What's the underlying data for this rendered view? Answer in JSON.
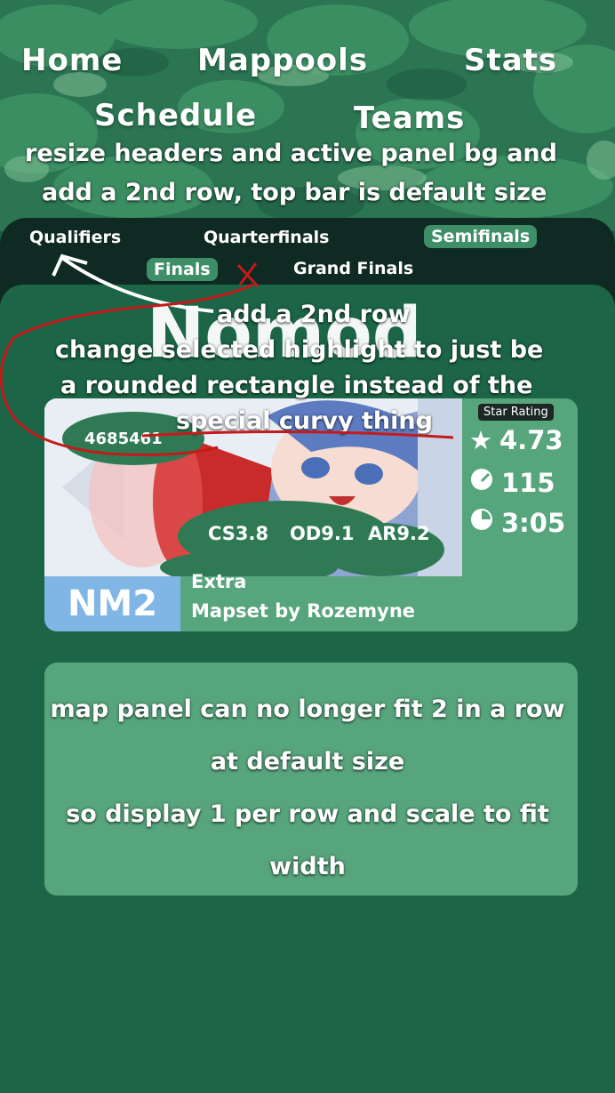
{
  "nav": {
    "home": "Home",
    "mappools": "Mappools",
    "stats": "Stats",
    "schedule": "Schedule",
    "teams": "Teams"
  },
  "notes": {
    "header_line1": "resize headers and active panel bg and",
    "header_line2": "add a 2nd row, top bar is default size",
    "row_note": "add a 2nd row",
    "highlight_line1": "change selected highlight to just be",
    "highlight_line2": "a rounded rectangle instead of the",
    "highlight_line3": "special curvy thing",
    "panel_line1": "map panel can no longer fit 2 in a row",
    "panel_line2": "at default size",
    "panel_line3": "so display 1 per row and scale to fit",
    "panel_line4": "width"
  },
  "tabs": {
    "qualifiers": "Qualifiers",
    "quarterfinals": "Quarterfinals",
    "semifinals": "Semifinals",
    "finals": "Finals",
    "grand_finals": "Grand Finals",
    "active": "semifinals"
  },
  "pool": {
    "heading": "Nomod"
  },
  "map": {
    "beatmap_id": "4685461",
    "star_label": "Star Rating",
    "stars": "4.73",
    "bpm": "115",
    "length": "3:05",
    "cs": "CS3.8",
    "od": "OD9.1",
    "ar": "AR9.2",
    "mod_slot": "NM2",
    "difficulty": "Extra",
    "mapper": "Mapset by Rozemyne"
  },
  "colors": {
    "page_bg": "#165d44",
    "top_bar": "#2d7a55",
    "tab_bar": "#0f2a22",
    "active_tab": "#3e8f68",
    "card": "#57a57c",
    "mod_tag": "#7fb6e6",
    "annotation_red": "#c41a1a"
  }
}
